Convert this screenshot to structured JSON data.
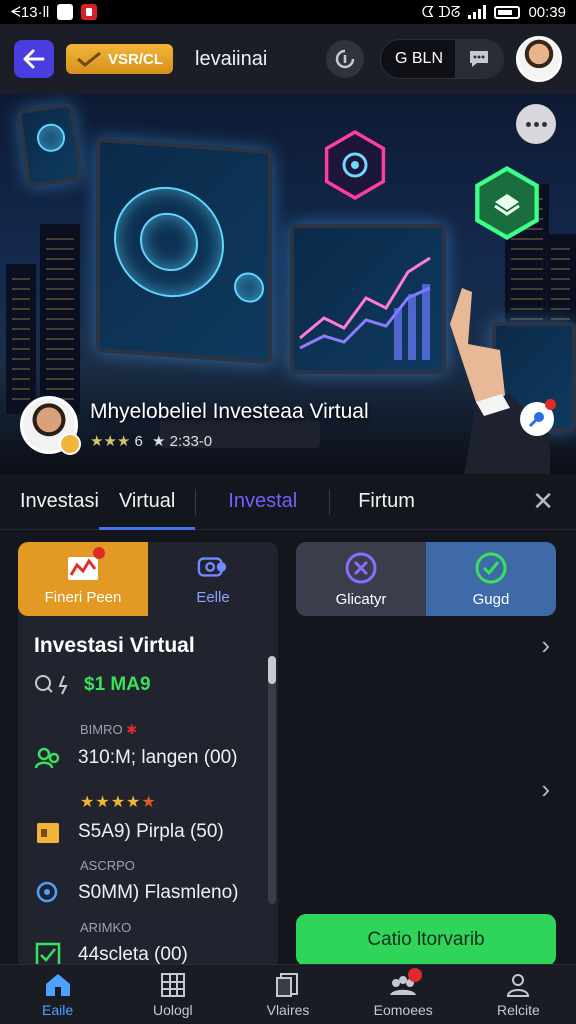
{
  "status_bar": {
    "left_text": "ᗕ13·ll",
    "time": "00:39",
    "right_label": "ᗧ ᗪᘔ"
  },
  "header": {
    "badge_label": "VSR/CL",
    "title": "levaiinai",
    "pill_label": "G BLN",
    "icons": [
      "back-arrow-icon",
      "check-mark-icon",
      "refresh-icon",
      "chat-icon",
      "avatar"
    ]
  },
  "hero": {
    "title": "Mhyelobeliel Investeaa Virtual",
    "rating_stars": "★★★",
    "rating_extra": "6",
    "stat": "★ 2:33-0"
  },
  "tabs": [
    {
      "label": "Investasi"
    },
    {
      "label": "Virtual"
    },
    {
      "label": "Investal"
    },
    {
      "label": "Firtum"
    }
  ],
  "left_card": {
    "segments": [
      {
        "label": "Fineri Peen",
        "icon": "chart-icon"
      },
      {
        "label": "Eelle",
        "icon": "camera-icon"
      }
    ],
    "title": "Investasi Virtual",
    "money": "$1 MA9",
    "items": [
      {
        "small": "BIMRO",
        "text": "310:M; langen (00)",
        "icon": "people-icon"
      },
      {
        "stars": "★★★★",
        "star_half": "★",
        "text": "S5A9) Pirpla (50)",
        "icon": "folder-icon"
      },
      {
        "small": "ASCRPO",
        "text": "S0MM) Flasmleno)",
        "icon": "search-icon"
      },
      {
        "small": "ARIMKO",
        "text": "44scleta (00)",
        "icon": "checkbox-icon"
      }
    ]
  },
  "right_panel": {
    "segments": [
      {
        "label": "Glicatyr",
        "icon": "close-circle-icon"
      },
      {
        "label": "Gugd",
        "icon": "check-circle-icon"
      }
    ],
    "cta_label": "Catio ltorvarib"
  },
  "bottom_nav": [
    {
      "label": "Eaile",
      "icon": "home-icon"
    },
    {
      "label": "Uologl",
      "icon": "grid-icon"
    },
    {
      "label": "Vlaires",
      "icon": "document-icon"
    },
    {
      "label": "Eomoees",
      "icon": "group-icon"
    },
    {
      "label": "Relcite",
      "icon": "profile-icon"
    }
  ],
  "colors": {
    "accent": "#4a3ee0",
    "orange": "#e29a24",
    "green": "#2fd45a",
    "blue": "#3f6aa8",
    "background": "#14161d"
  }
}
